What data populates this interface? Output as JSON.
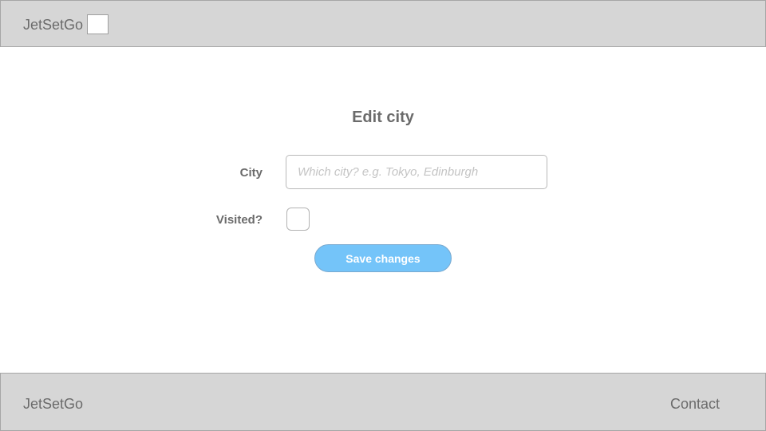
{
  "header": {
    "brand": "JetSetGo",
    "logo_icon": "logo-placeholder-icon"
  },
  "form": {
    "title": "Edit city",
    "city_label": "City",
    "city_placeholder": "Which city? e.g. Tokyo, Edinburgh",
    "city_value": "",
    "visited_label": "Visited?",
    "visited_checked": false,
    "save_label": "Save changes"
  },
  "footer": {
    "brand": "JetSetGo",
    "contact_label": "Contact"
  },
  "colors": {
    "header_bg": "#d6d6d6",
    "accent_button": "#74c4f9",
    "text": "#6b6b6b"
  }
}
